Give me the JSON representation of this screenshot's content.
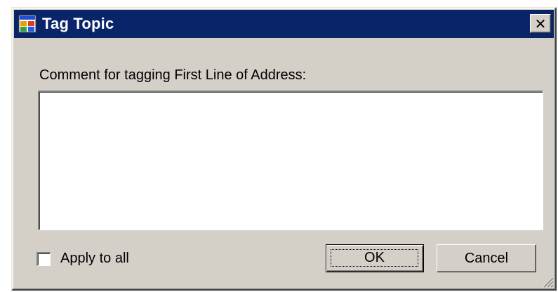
{
  "dialog": {
    "title": "Tag Topic",
    "close_glyph": "✕",
    "icons": {
      "app": "app-window-icon",
      "close": "close-icon",
      "grip": "resize-grip-icon"
    },
    "prompt_label": "Comment for tagging First Line of Address:",
    "comment": {
      "value": "",
      "placeholder": ""
    },
    "apply_to_all": {
      "label": "Apply to all",
      "checked": false
    },
    "buttons": {
      "ok": "OK",
      "cancel": "Cancel"
    },
    "colors": {
      "titlebar": "#0a246a",
      "face": "#d4d0c8",
      "title_text": "#ffffff"
    }
  }
}
